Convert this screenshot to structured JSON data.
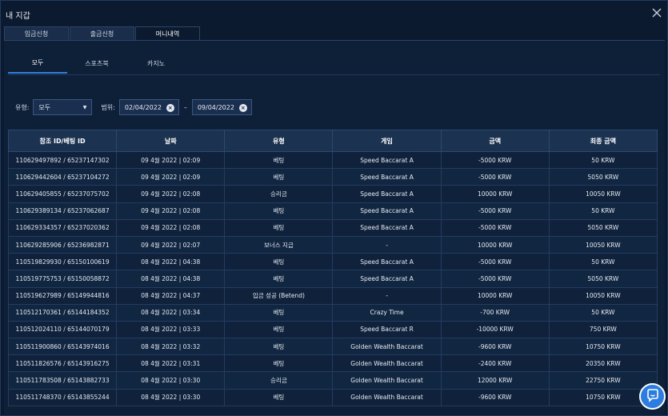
{
  "window": {
    "title": "내 지갑"
  },
  "top_tabs": [
    "입금신청",
    "출금신청",
    "머니내역"
  ],
  "active_top_tab": 2,
  "sub_tabs": [
    "모두",
    "스포츠북",
    "카지노"
  ],
  "active_sub_tab": 0,
  "filters": {
    "type_label": "유형:",
    "type_value": "모두",
    "range_label": "범위:",
    "date_from": "02/04/2022",
    "date_separator": "–",
    "date_to": "09/04/2022"
  },
  "table": {
    "headers": [
      "참조 ID/베팅 ID",
      "날짜",
      "유형",
      "게임",
      "금액",
      "최종 금액"
    ],
    "rows": [
      [
        "110629497892 / 65237147302",
        "09 4월 2022 | 02:09",
        "베팅",
        "Speed Baccarat A",
        "-5000 KRW",
        "50 KRW"
      ],
      [
        "110629442604 / 65237104272",
        "09 4월 2022 | 02:09",
        "베팅",
        "Speed Baccarat A",
        "-5000 KRW",
        "5050 KRW"
      ],
      [
        "110629405855 / 65237075702",
        "09 4월 2022 | 02:08",
        "승리금",
        "Speed Baccarat A",
        "10000 KRW",
        "10050 KRW"
      ],
      [
        "110629389134 / 65237062687",
        "09 4월 2022 | 02:08",
        "베팅",
        "Speed Baccarat A",
        "-5000 KRW",
        "50 KRW"
      ],
      [
        "110629334357 / 65237020362",
        "09 4월 2022 | 02:08",
        "베팅",
        "Speed Baccarat A",
        "-5000 KRW",
        "5050 KRW"
      ],
      [
        "110629285906 / 65236982871",
        "09 4월 2022 | 02:07",
        "보너스 지급",
        "-",
        "10000 KRW",
        "10050 KRW"
      ],
      [
        "110519829930 / 65150100619",
        "08 4월 2022 | 04:38",
        "베팅",
        "Speed Baccarat A",
        "-5000 KRW",
        "50 KRW"
      ],
      [
        "110519775753 / 65150058872",
        "08 4월 2022 | 04:38",
        "베팅",
        "Speed Baccarat A",
        "-5000 KRW",
        "5050 KRW"
      ],
      [
        "110519627989 / 65149944816",
        "08 4월 2022 | 04:37",
        "입금 성공 (Betend)",
        "-",
        "10000 KRW",
        "10050 KRW"
      ],
      [
        "110512170361 / 65144184352",
        "08 4월 2022 | 03:34",
        "베팅",
        "Crazy Time",
        "-700 KRW",
        "50 KRW"
      ],
      [
        "110512024110 / 65144070179",
        "08 4월 2022 | 03:33",
        "베팅",
        "Speed Baccarat R",
        "-10000 KRW",
        "750 KRW"
      ],
      [
        "110511900860 / 65143974016",
        "08 4월 2022 | 03:32",
        "베팅",
        "Golden Wealth Baccarat",
        "-9600 KRW",
        "10750 KRW"
      ],
      [
        "110511826576 / 65143916275",
        "08 4월 2022 | 03:31",
        "베팅",
        "Golden Wealth Baccarat",
        "-2400 KRW",
        "20350 KRW"
      ],
      [
        "110511783508 / 65143882733",
        "08 4월 2022 | 03:30",
        "승리금",
        "Golden Wealth Baccarat",
        "12000 KRW",
        "22750 KRW"
      ],
      [
        "110511748370 / 65143855244",
        "08 4월 2022 | 03:30",
        "베팅",
        "Golden Wealth Baccarat",
        "-9600 KRW",
        "10750 KRW"
      ]
    ]
  },
  "icons": {
    "close": "close-icon",
    "chat": "chat-bubble-icon",
    "caret": "chevron-down-icon",
    "clear": "clear-icon"
  },
  "colors": {
    "accent": "#2f7fd6",
    "chat_button": "#2b7de0",
    "background": "#0c1a2f"
  }
}
